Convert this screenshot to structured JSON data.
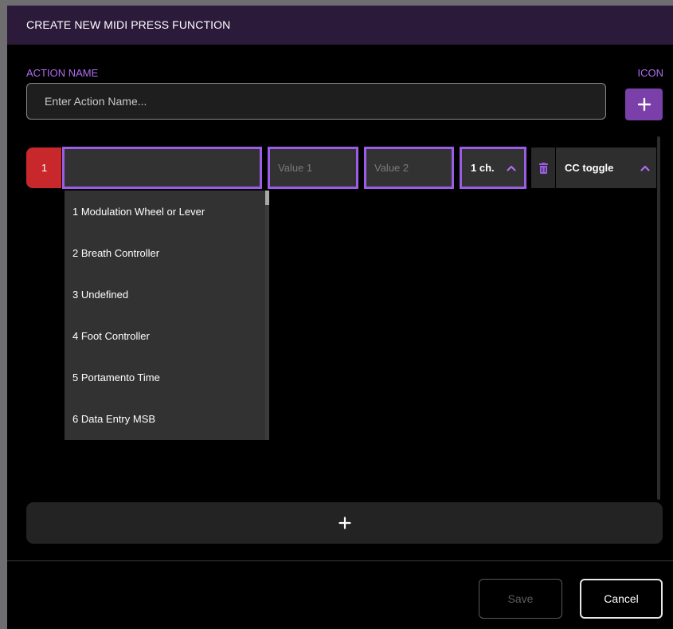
{
  "dialog": {
    "title": "CREATE NEW MIDI PRESS FUNCTION",
    "action_name_label": "ACTION NAME",
    "action_name_placeholder": "Enter Action Name...",
    "action_name_value": "",
    "icon_label": "ICON",
    "icon_button_icon": "plus-icon"
  },
  "row": {
    "index": "1",
    "cc_search_value": "",
    "value1_placeholder": "Value 1",
    "value2_placeholder": "Value 2",
    "channel": "1 ch.",
    "channel_icon": "chevron-up-icon",
    "delete_icon": "trash-icon",
    "type": "CC toggle",
    "type_icon": "chevron-up-icon"
  },
  "dropdown": {
    "options": [
      "1 Modulation Wheel or Lever",
      "2 Breath Controller",
      "3 Undefined",
      "4 Foot Controller",
      "5 Portamento Time",
      "6 Data Entry MSB"
    ]
  },
  "add_row": {
    "icon": "plus-icon"
  },
  "footer": {
    "save_label": "Save",
    "cancel_label": "Cancel"
  },
  "colors": {
    "accent_purple": "#9b5de5",
    "label_purple": "#b06cf0",
    "title_bar": "#2b1a3a",
    "index_red": "#c8282c",
    "icon_button_purple": "#7a3fa8"
  }
}
